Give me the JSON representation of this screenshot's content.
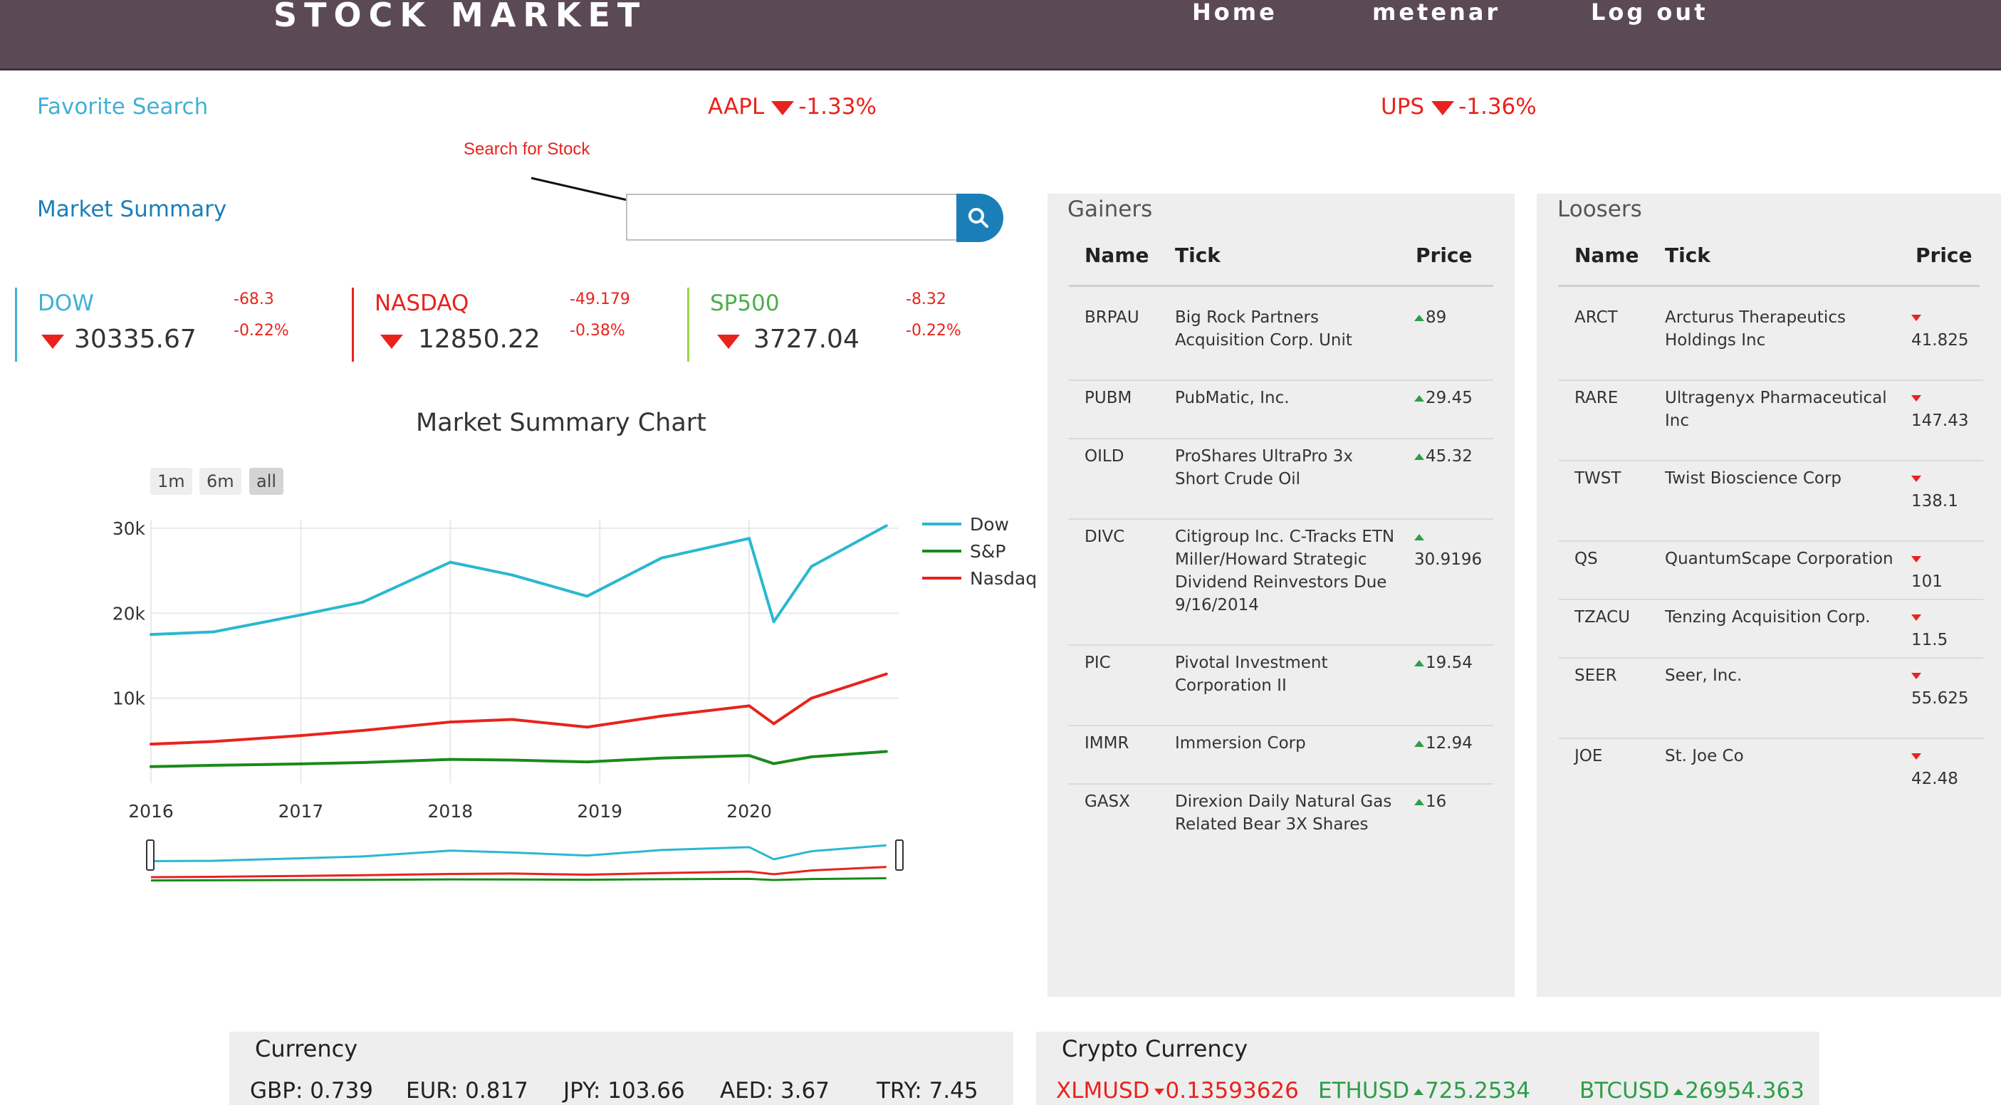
{
  "header": {
    "brand": "STOCK MARKET",
    "nav": [
      "Home",
      "metenar",
      "Log out"
    ]
  },
  "favorites": {
    "label": "Favorite Search",
    "items": [
      {
        "symbol": "AAPL",
        "change": "-1.33%"
      },
      {
        "symbol": "UPS",
        "change": "-1.36%"
      }
    ]
  },
  "search": {
    "annotation": "Search for Stock",
    "placeholder": ""
  },
  "market_summary": {
    "label": "Market Summary",
    "indices": [
      {
        "name": "DOW",
        "value": "30335.67",
        "change": "-68.3",
        "percent": "-0.22%",
        "color": "#42b0d5"
      },
      {
        "name": "NASDAQ",
        "value": "12850.22",
        "change": "-49.179",
        "percent": "-0.38%",
        "color": "#e8231d"
      },
      {
        "name": "SP500",
        "value": "3727.04",
        "change": "-8.32",
        "percent": "-0.22%",
        "color": "#4cae4c"
      }
    ]
  },
  "chart": {
    "title": "Market Summary Chart",
    "range_buttons": [
      "1m",
      "6m",
      "all"
    ],
    "active_range": "all"
  },
  "chart_data": {
    "type": "line",
    "title": "Market Summary Chart",
    "x": [
      "2016-01",
      "2016-06",
      "2017-01",
      "2017-06",
      "2018-01",
      "2018-06",
      "2018-12",
      "2019-06",
      "2020-01",
      "2020-03",
      "2020-06",
      "2020-12"
    ],
    "x_ticks": [
      "2016",
      "2017",
      "2018",
      "2019",
      "2020"
    ],
    "y_ticks": [
      "10k",
      "20k",
      "30k"
    ],
    "ylim": [
      0,
      31000
    ],
    "series": [
      {
        "name": "Dow",
        "color": "#2ab8d0",
        "values": [
          17500,
          17800,
          19800,
          21300,
          26000,
          24500,
          22000,
          26500,
          28800,
          19000,
          25500,
          30300
        ]
      },
      {
        "name": "S&P",
        "color": "#1a8a1a",
        "values": [
          1950,
          2100,
          2270,
          2430,
          2800,
          2720,
          2500,
          2950,
          3250,
          2300,
          3100,
          3730
        ]
      },
      {
        "name": "Nasdaq",
        "color": "#e8231d",
        "values": [
          4600,
          4900,
          5600,
          6200,
          7200,
          7500,
          6600,
          7900,
          9100,
          7000,
          10000,
          12850
        ]
      }
    ],
    "legend": "right",
    "grid": true
  },
  "gainers": {
    "title": "Gainers",
    "columns": [
      "Name",
      "Tick",
      "Price"
    ],
    "rows": [
      {
        "name": "BRPAU",
        "tick1": "Big Rock Partners",
        "tick2": "Acquisition Corp. Unit",
        "price": "89"
      },
      {
        "name": "PUBM",
        "tick1": "PubMatic, Inc.",
        "price": "29.45"
      },
      {
        "name": "OILD",
        "tick1": "ProShares UltraPro 3x",
        "tick2": "Short Crude Oil",
        "price": "45.32"
      },
      {
        "name": "DIVC",
        "tick1": "Citigroup Inc. C-Tracks ETN",
        "tick2": "Miller/Howard Strategic",
        "tick3": "Dividend Reinvestors Due",
        "tick4": "9/16/2014",
        "price": "30.9196"
      },
      {
        "name": "PIC",
        "tick1": "Pivotal Investment",
        "tick2": "Corporation II",
        "price": "19.54"
      },
      {
        "name": "IMMR",
        "tick1": "Immersion Corp",
        "price": "12.94"
      },
      {
        "name": "GASX",
        "tick1": "Direxion Daily Natural Gas",
        "tick2": "Related Bear 3X Shares",
        "price": "16"
      }
    ]
  },
  "loosers": {
    "title": "Loosers",
    "columns": [
      "Name",
      "Tick",
      "Price"
    ],
    "rows": [
      {
        "name": "ARCT",
        "tick1": "Arcturus Therapeutics",
        "tick2": "Holdings Inc",
        "price": "41.825"
      },
      {
        "name": "RARE",
        "tick1": "Ultragenyx Pharmaceutical",
        "tick2": "Inc",
        "price": "147.43"
      },
      {
        "name": "TWST",
        "tick1": "Twist Bioscience Corp",
        "price": "138.1"
      },
      {
        "name": "QS",
        "tick1": "QuantumScape Corporation",
        "price": "101"
      },
      {
        "name": "TZACU",
        "tick1": "Tenzing Acquisition Corp.",
        "price": "11.5"
      },
      {
        "name": "SEER",
        "tick1": "Seer, Inc.",
        "price": "55.625"
      },
      {
        "name": "JOE",
        "tick1": "St. Joe Co",
        "price": "42.48"
      }
    ]
  },
  "currency": {
    "title": "Currency",
    "items": [
      "GBP: 0.739",
      "EUR: 0.817",
      "JPY: 103.66",
      "AED: 3.67",
      "TRY: 7.45"
    ]
  },
  "crypto": {
    "title": "Crypto Currency",
    "items": [
      {
        "symbol": "XLMUSD",
        "value": "0.13593626",
        "direction": "down"
      },
      {
        "symbol": "ETHUSD",
        "value": "725.2534",
        "direction": "up"
      },
      {
        "symbol": "BTCUSD",
        "value": "26954.363",
        "direction": "up"
      }
    ]
  }
}
